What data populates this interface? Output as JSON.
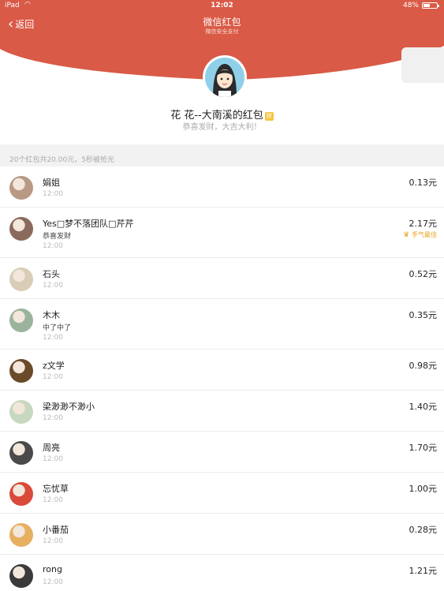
{
  "status_bar": {
    "carrier": "iPad",
    "time": "12:02",
    "battery": "48%",
    "battery_level": 0.48
  },
  "nav": {
    "back_label": "返回",
    "title": "微信红包",
    "subtitle": "微信安全支付"
  },
  "header": {
    "sender": "花 花--大南溪的红包",
    "greeting": "恭喜发财，大吉大利！"
  },
  "summary": "20个红包共20.00元，5秒被抢光",
  "recipients": [
    {
      "name": "娟姐",
      "time": "12:00",
      "amount": "0.13元",
      "avatar_color": "#b89a84"
    },
    {
      "name": "Yes□梦不落团队□芹芹",
      "message": "恭喜发财",
      "time": "12:00",
      "amount": "2.17元",
      "best": "手气最佳",
      "avatar_color": "#8a6a5c"
    },
    {
      "name": "石头",
      "time": "12:00",
      "amount": "0.52元",
      "avatar_color": "#d9cdb8"
    },
    {
      "name": "木木",
      "message": "中了中了",
      "time": "12:00",
      "amount": "0.35元",
      "avatar_color": "#9bb39a"
    },
    {
      "name": "z文学",
      "time": "12:00",
      "amount": "0.98元",
      "avatar_color": "#6b4a2a"
    },
    {
      "name": "梁渺渺不渺小",
      "time": "12:00",
      "amount": "1.40元",
      "avatar_color": "#c8d8c0"
    },
    {
      "name": "周亮",
      "time": "12:00",
      "amount": "1.70元",
      "avatar_color": "#4a4a4a"
    },
    {
      "name": "忘忧草",
      "time": "12:00",
      "amount": "1.00元",
      "avatar_color": "#d94a3a"
    },
    {
      "name": "小番茄",
      "time": "12:00",
      "amount": "0.28元",
      "avatar_color": "#e6b060"
    },
    {
      "name": "rong",
      "time": "12:00",
      "amount": "1.21元",
      "avatar_color": "#3a3a3a"
    }
  ],
  "colors": {
    "header_red": "#d95a46",
    "best_gold": "#e8a21b"
  }
}
